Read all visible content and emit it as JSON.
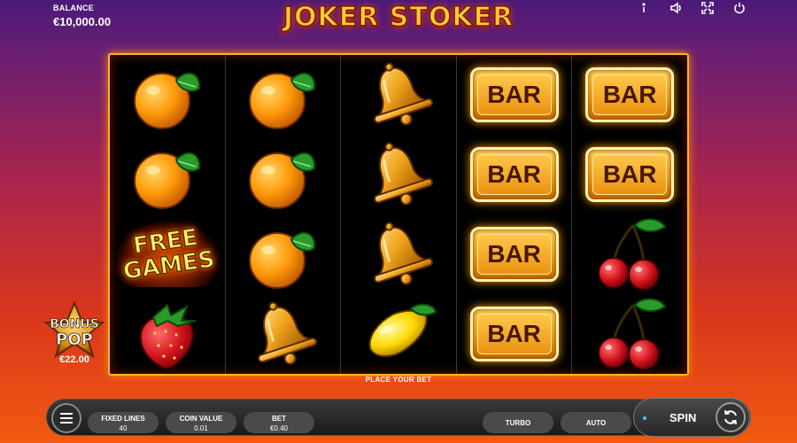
{
  "header": {
    "balance_label": "BALANCE",
    "balance_value": "€10,000.00",
    "title": "JOKER STOKER",
    "icons": [
      "info-icon",
      "sound-icon",
      "fullscreen-icon",
      "power-icon"
    ]
  },
  "reels": [
    [
      "orange",
      "orange",
      "free-games",
      "strawberry"
    ],
    [
      "orange",
      "orange",
      "orange",
      "bell"
    ],
    [
      "bell",
      "bell",
      "bell",
      "lemon"
    ],
    [
      "bar",
      "bar",
      "bar",
      "bar"
    ],
    [
      "bar",
      "bar",
      "cherry",
      "cherry"
    ]
  ],
  "symbols": {
    "bar_label": "BAR",
    "free_games_line1": "FREE",
    "free_games_line2": "GAMES"
  },
  "bonus_pop": {
    "line1": "BONUS",
    "line2": "POP",
    "amount": "€22.00"
  },
  "controls": {
    "place_bet_label": "PLACE YOUR BET",
    "fixed_lines_label": "FIXED LINES",
    "fixed_lines_value": "40",
    "coin_value_label": "COIN VALUE",
    "coin_value_value": "0.01",
    "bet_label": "BET",
    "bet_value": "€0.40",
    "turbo_label": "TURBO",
    "auto_label": "AUTO",
    "spin_label": "SPIN"
  },
  "colors": {
    "frame": "#f6b52b",
    "title": "#ffcc33",
    "spin_dot": "#39c7ff"
  }
}
